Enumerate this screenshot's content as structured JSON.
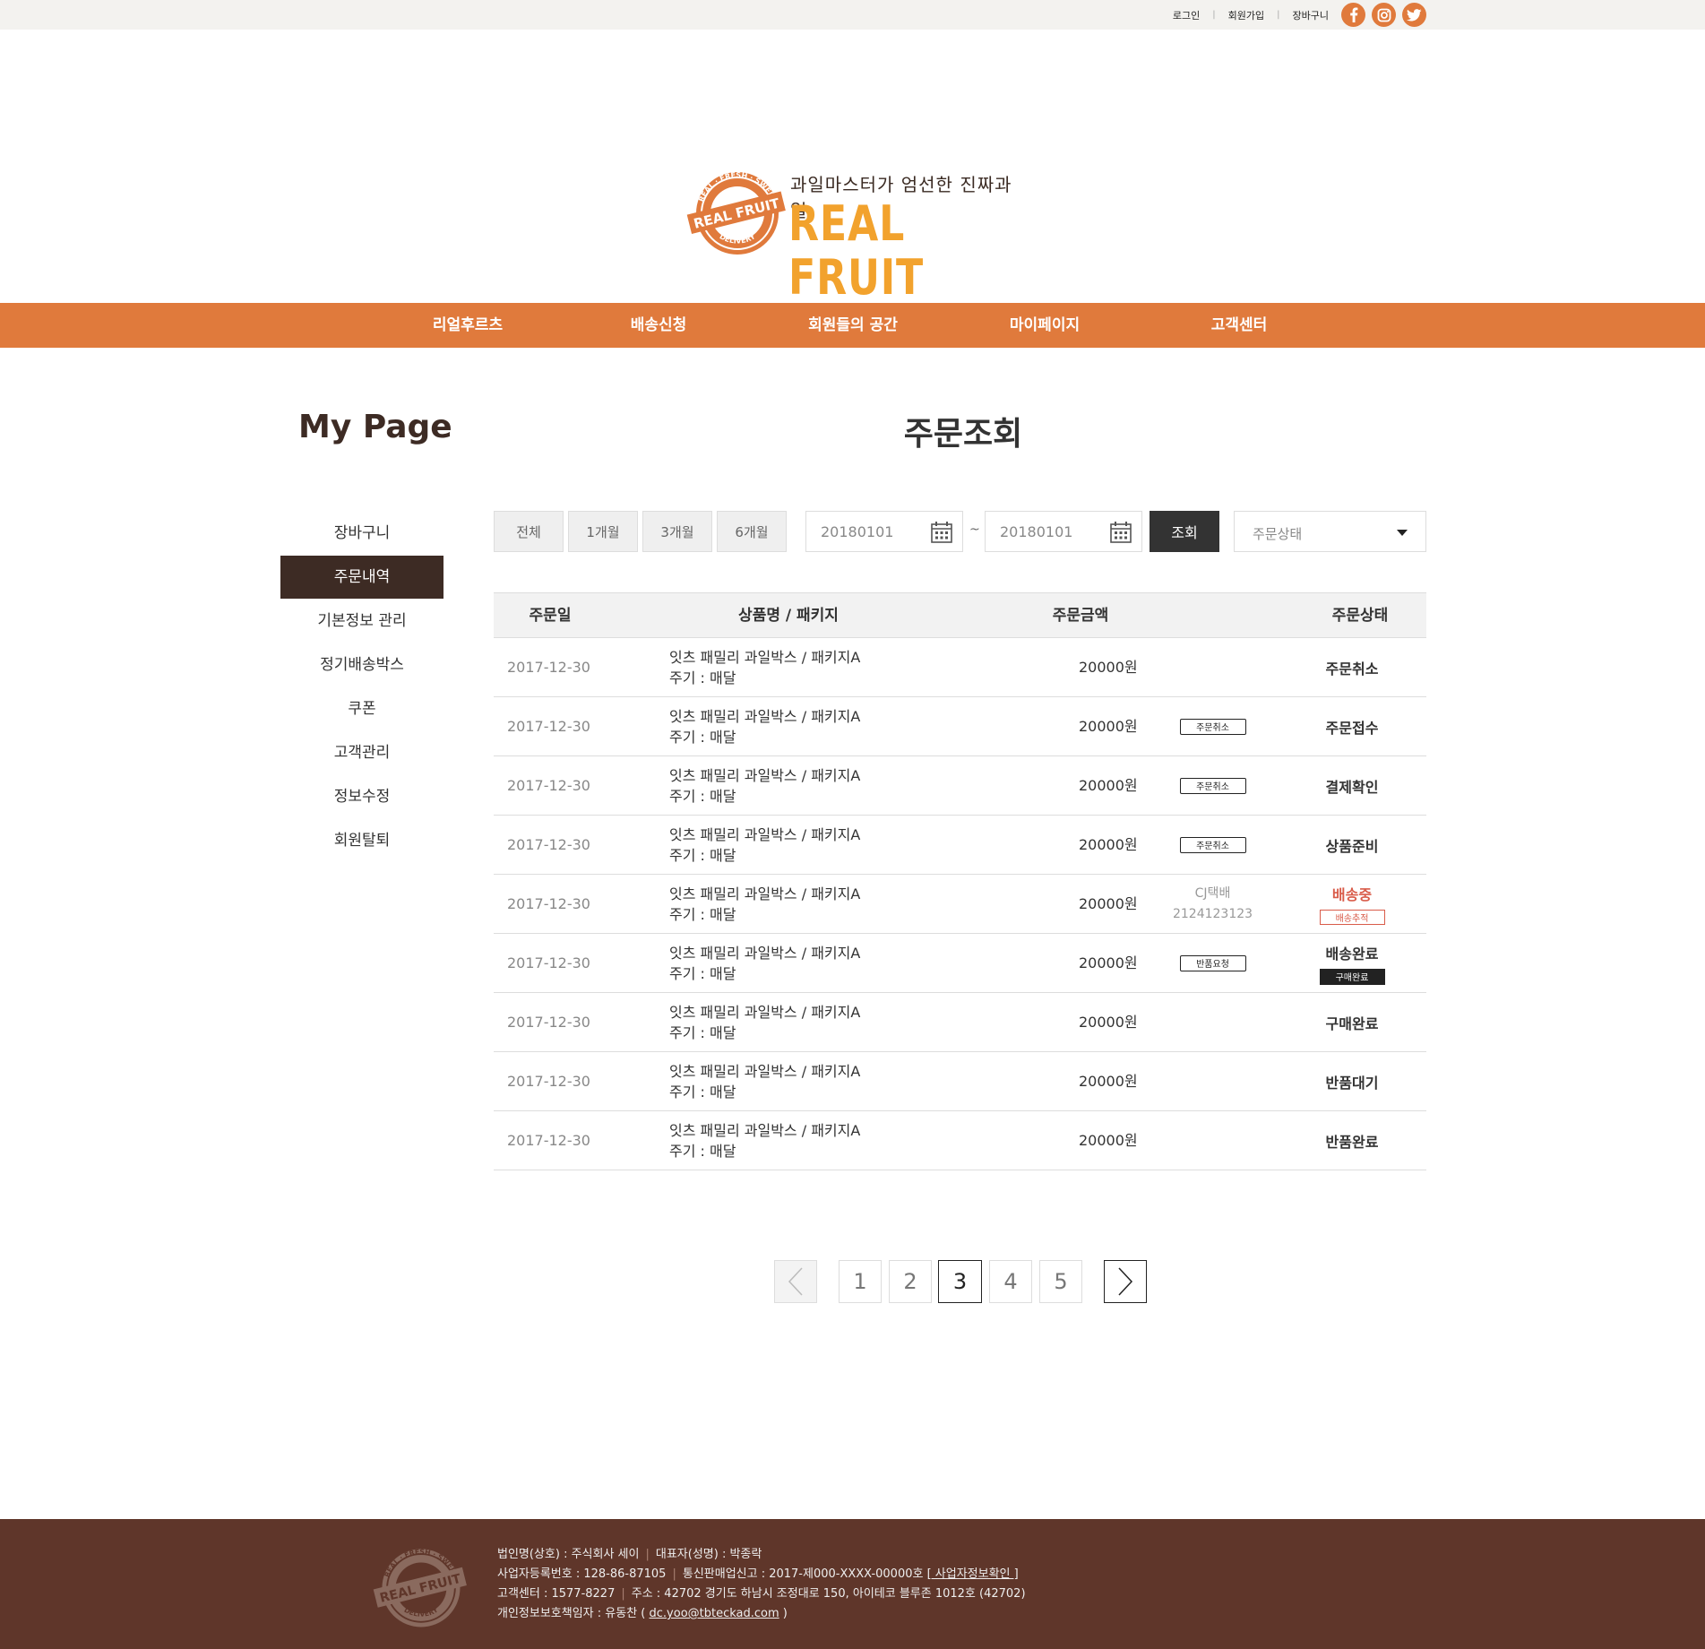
{
  "topbar": {
    "login": "로그인",
    "join": "회원가입",
    "cart": "장바구니",
    "social_icons": [
      "facebook-icon",
      "instagram-icon",
      "twitter-icon"
    ],
    "accent_color": "#e07a3c"
  },
  "logo": {
    "badge_top": "REAL · FRESH · SWEET",
    "badge_main": "REAL FRUIT",
    "badge_bottom": "DELIVERY",
    "tagline": "과일마스터가 엄선한 진짜과일",
    "wordmark": "REAL FRUIT"
  },
  "nav": {
    "items": [
      "리얼후르츠",
      "배송신청",
      "회원들의 공간",
      "마이페이지",
      "고객센터"
    ]
  },
  "sidebar": {
    "title": "My Page",
    "items": [
      "장바구니",
      "주문내역",
      "기본정보 관리",
      "정기배송박스",
      "쿠폰",
      "고객관리",
      "정보수정",
      "회원탈퇴"
    ],
    "active": "주문내역"
  },
  "main": {
    "title": "주문조회",
    "filters": {
      "periods": [
        "전체",
        "1개월",
        "3개월",
        "6개월"
      ],
      "date_from": "20180101",
      "date_to": "20180101",
      "tilde": "~",
      "search": "조회",
      "status_select": "주문상태"
    },
    "table": {
      "headers": {
        "date": "주문일",
        "product": "상품명 / 패키지",
        "amount": "주문금액",
        "status": "주문상태"
      },
      "rows": [
        {
          "date": "2017-12-30",
          "product": "잇츠 패밀리 과일박스 / 패키지A",
          "cycle": "주기 : 매달",
          "amount": "20000원",
          "action": "",
          "courier": "",
          "tracking": "",
          "status": "주문취소",
          "status_btn": ""
        },
        {
          "date": "2017-12-30",
          "product": "잇츠 패밀리 과일박스 / 패키지A",
          "cycle": "주기 : 매달",
          "amount": "20000원",
          "action": "주문취소",
          "courier": "",
          "tracking": "",
          "status": "주문접수",
          "status_btn": ""
        },
        {
          "date": "2017-12-30",
          "product": "잇츠 패밀리 과일박스 / 패키지A",
          "cycle": "주기 : 매달",
          "amount": "20000원",
          "action": "주문취소",
          "courier": "",
          "tracking": "",
          "status": "결제확인",
          "status_btn": ""
        },
        {
          "date": "2017-12-30",
          "product": "잇츠 패밀리 과일박스 / 패키지A",
          "cycle": "주기 : 매달",
          "amount": "20000원",
          "action": "주문취소",
          "courier": "",
          "tracking": "",
          "status": "상품준비",
          "status_btn": ""
        },
        {
          "date": "2017-12-30",
          "product": "잇츠 패밀리 과일박스 / 패키지A",
          "cycle": "주기 : 매달",
          "amount": "20000원",
          "action": "",
          "courier": "CJ택배",
          "tracking": "2124123123",
          "status": "배송중",
          "status_btn": "배송추적"
        },
        {
          "date": "2017-12-30",
          "product": "잇츠 패밀리 과일박스 / 패키지A",
          "cycle": "주기 : 매달",
          "amount": "20000원",
          "action": "반품요청",
          "courier": "",
          "tracking": "",
          "status": "배송완료",
          "status_btn": "구매완료"
        },
        {
          "date": "2017-12-30",
          "product": "잇츠 패밀리 과일박스 / 패키지A",
          "cycle": "주기 : 매달",
          "amount": "20000원",
          "action": "",
          "courier": "",
          "tracking": "",
          "status": "구매완료",
          "status_btn": ""
        },
        {
          "date": "2017-12-30",
          "product": "잇츠 패밀리 과일박스 / 패키지A",
          "cycle": "주기 : 매달",
          "amount": "20000원",
          "action": "",
          "courier": "",
          "tracking": "",
          "status": "반품대기",
          "status_btn": ""
        },
        {
          "date": "2017-12-30",
          "product": "잇츠 패밀리 과일박스 / 패키지A",
          "cycle": "주기 : 매달",
          "amount": "20000원",
          "action": "",
          "courier": "",
          "tracking": "",
          "status": "반품완료",
          "status_btn": ""
        }
      ]
    },
    "pagination": {
      "pages": [
        "1",
        "2",
        "3",
        "4",
        "5"
      ],
      "current": "3"
    }
  },
  "footer": {
    "company": "법인명(상호) : 주식회사 세이",
    "ceo": "대표자(성명) : 박종락",
    "biz_no": "사업자등록번호 : 128-86-87105",
    "mail_order": "통신판매업신고 : 2017-제000-XXXX-00000호",
    "biz_check": "[ 사업자정보확인 ]",
    "cs": "고객센터 : 1577-8227",
    "address": "주소 : 42702 경기도 하남시 조정대로 150, 아이테코 블루존 1012호 (42702)",
    "privacy_prefix": "개인정보보호책임자 : 유동찬 (",
    "privacy_email": "dc.yoo@tbteckad.com",
    "privacy_suffix": ")"
  }
}
